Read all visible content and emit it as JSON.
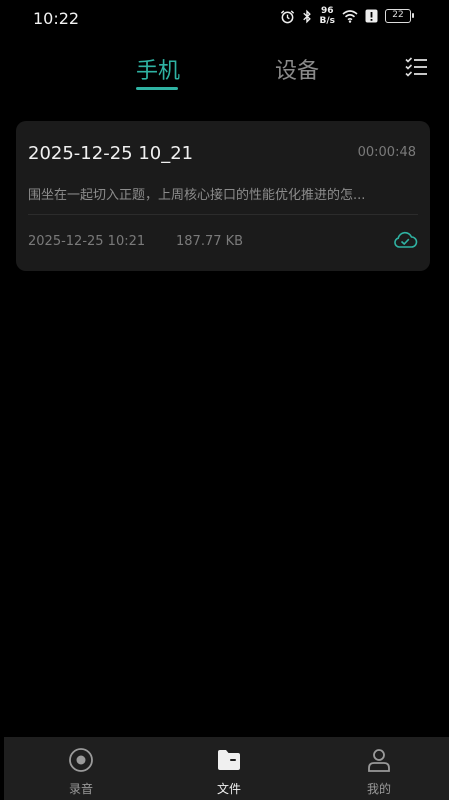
{
  "status_bar": {
    "time": "10:22",
    "net_speed_value": "96",
    "net_speed_unit": "B/s",
    "battery": "22",
    "icons": [
      "alarm-icon",
      "bluetooth-icon",
      "wifi-icon",
      "alert-icon",
      "battery-icon"
    ]
  },
  "tabs": {
    "phone": "手机",
    "device": "设备",
    "active": "phone"
  },
  "recording": {
    "title": "2025-12-25 10_21",
    "duration": "00:00:48",
    "summary": "围坐在一起切入正题，上周核心接口的性能优化推进的怎...",
    "date": "2025-12-25 10:21",
    "size": "187.77 KB",
    "cloud_status": "cloud-synced-icon"
  },
  "bottom_nav": {
    "record_label": "录音",
    "files_label": "文件",
    "mine_label": "我的",
    "active": "files"
  },
  "colors": {
    "accent": "#2fb3a3",
    "background": "#000000",
    "card": "#1b1b1b",
    "nav_bar": "#1f1f1f"
  }
}
